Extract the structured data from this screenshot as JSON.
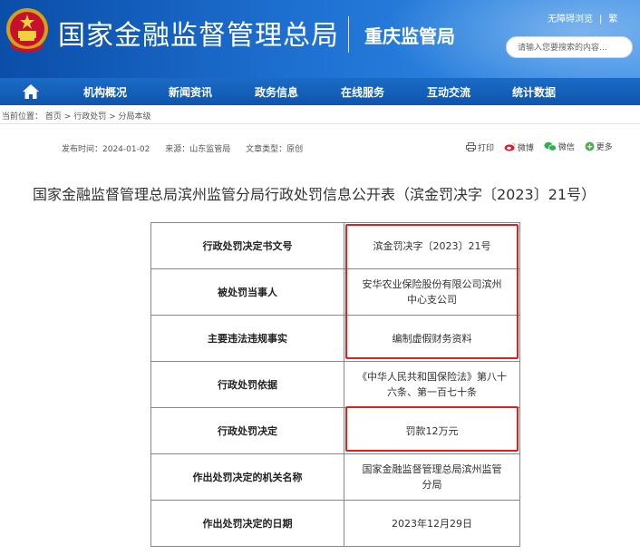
{
  "header": {
    "org_name": "国家金融监督管理总局",
    "branch_name": "重庆监管局",
    "links": [
      "无障碍浏览",
      "繁"
    ],
    "search_placeholder": "请输入您要搜索的内容..."
  },
  "nav": {
    "items": [
      "机构概况",
      "新闻资讯",
      "政务信息",
      "在线服务",
      "互动交流",
      "统计数据"
    ]
  },
  "breadcrumb": {
    "prefix": "当前位置：",
    "items": [
      "首页",
      "行政处罚",
      "分局本级"
    ],
    "separator": " > "
  },
  "meta": {
    "publish_time": "发布时间：2024-01-02",
    "source": "来源：山东监管局",
    "doc_type": "文章类型：原创"
  },
  "share": {
    "print": "打印",
    "weibo": "微博",
    "wechat": "微信",
    "more": "更多"
  },
  "article": {
    "title": "国家金融监督管理总局滨州监管分局行政处罚信息公开表（滨金罚决字〔2023〕21号）",
    "rows": [
      {
        "label": "行政处罚决定书文号",
        "value": "滨金罚决字〔2023〕21号"
      },
      {
        "label": "被处罚当事人",
        "value": "安华农业保险股份有限公司滨州中心支公司"
      },
      {
        "label": "主要违法违规事实",
        "value": "编制虚假财务资料"
      },
      {
        "label": "行政处罚依据",
        "value": "《中华人民共和国保险法》第八十六条、第一百七十条"
      },
      {
        "label": "行政处罚决定",
        "value": "罚款12万元"
      },
      {
        "label": "作出处罚决定的机关名称",
        "value": "国家金融监督管理总局滨州监管分局"
      },
      {
        "label": "作出处罚决定的日期",
        "value": "2023年12月29日"
      }
    ]
  },
  "colors": {
    "header_blue": "#1d6fd0",
    "nav_blue": "#0d55ad",
    "highlight_red": "#e02020"
  }
}
